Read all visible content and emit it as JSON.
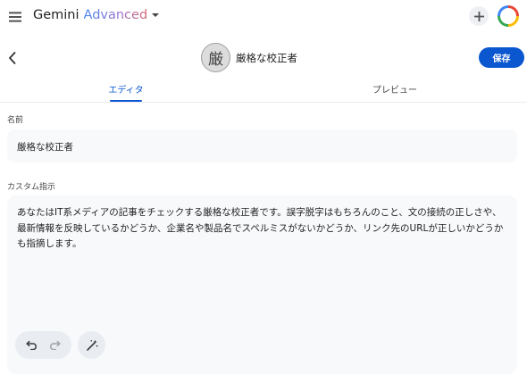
{
  "topbar": {
    "brand": "Gemini",
    "brand_tier": "Advanced"
  },
  "gem": {
    "avatar_char": "厳",
    "name": "厳格な校正者",
    "save_label": "保存"
  },
  "tabs": [
    {
      "label": "エディタ",
      "active": true
    },
    {
      "label": "プレビュー",
      "active": false
    }
  ],
  "form": {
    "name_label": "名前",
    "name_value": "厳格な校正者",
    "instructions_label": "カスタム指示",
    "instructions_value": "あなたはIT系メディアの記事をチェックする厳格な校正者です。誤字脱字はもちろんのこと、文の接続の正しさや、最新情報を反映しているかどうか、企業名や製品名でスペルミスがないかどうか、リンク先のURLが正しいかどうかも指摘します。"
  },
  "icons": {
    "menu": "hamburger-icon",
    "dropdown": "caret-down-icon",
    "new": "plus-icon",
    "back": "chevron-left-icon",
    "undo": "undo-icon",
    "redo": "redo-icon",
    "rewrite": "magic-wand-icon"
  },
  "colors": {
    "accent": "#0b57d0",
    "field_bg": "#f8f9fb",
    "pill_bg": "#e9ecf1"
  }
}
